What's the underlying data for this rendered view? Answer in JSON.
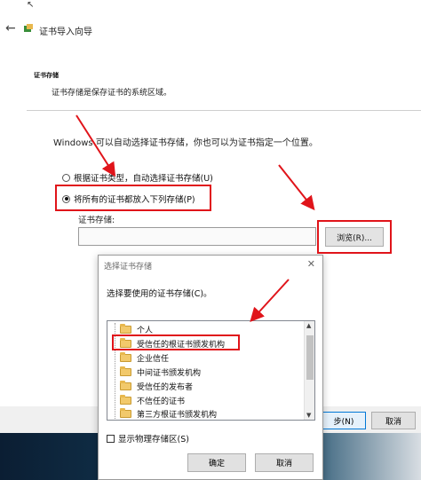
{
  "wizard": {
    "title": "证书导入向导",
    "section_title": "证书存储",
    "section_desc": "证书存储是保存证书的系统区域。",
    "intro": "Windows 可以自动选择证书存储，你也可以为证书指定一个位置。",
    "radio_auto": "根据证书类型，自动选择证书存储(U)",
    "radio_manual": "将所有的证书都放入下列存储(P)",
    "store_label": "证书存储:",
    "store_value": "",
    "browse_label": "浏览(R)...",
    "next_label": "步(N)",
    "cancel_label": "取消"
  },
  "dialog": {
    "title": "选择证书存储",
    "prompt": "选择要使用的证书存储(C)。",
    "items": [
      "个人",
      "受信任的根证书颁发机构",
      "企业信任",
      "中间证书颁发机构",
      "受信任的发布者",
      "不信任的证书",
      "第三方根证书颁发机构"
    ],
    "show_physical": "显示物理存储区(S)",
    "ok_label": "确定",
    "cancel_label": "取消"
  },
  "colors": {
    "highlight": "#e0141a",
    "folder": "#f2c96b",
    "primary_border": "#0078d7"
  },
  "icons": {
    "back": "arrow-left-icon",
    "app": "certificate-icon",
    "close": "close-icon",
    "folder": "folder-icon"
  }
}
